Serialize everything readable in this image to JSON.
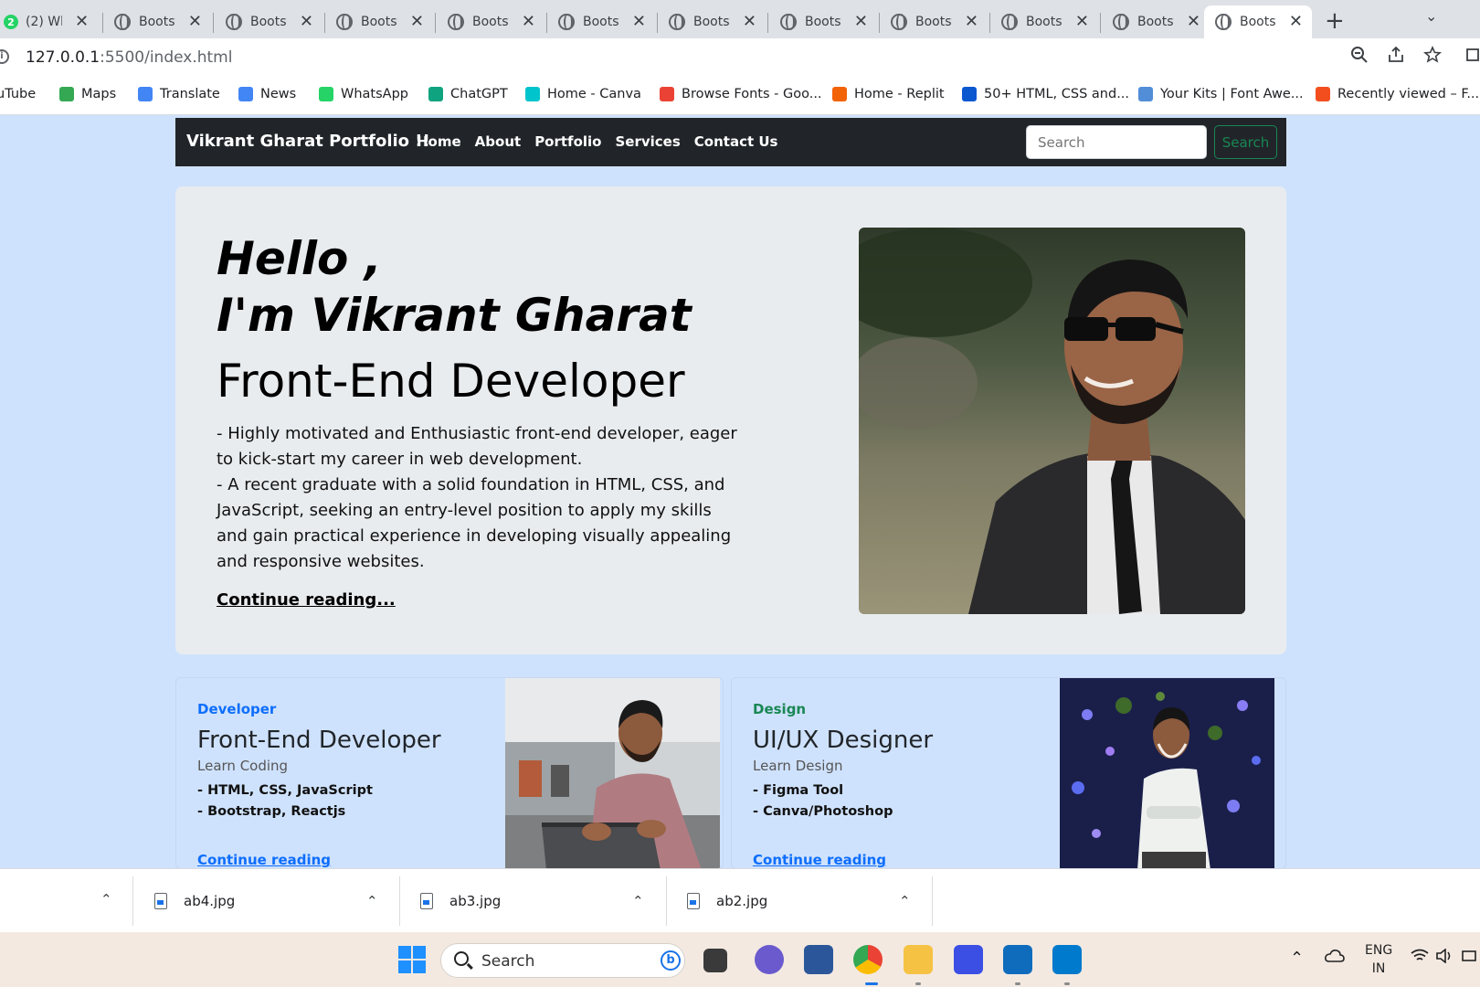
{
  "browser": {
    "tabs": [
      {
        "label": "(2) Wh",
        "kind": "whatsapp",
        "badge": "2"
      },
      {
        "label": "Bootst",
        "kind": "globe"
      },
      {
        "label": "Bootst",
        "kind": "globe"
      },
      {
        "label": "Bootst",
        "kind": "globe"
      },
      {
        "label": "Bootst",
        "kind": "globe"
      },
      {
        "label": "Bootst",
        "kind": "globe"
      },
      {
        "label": "Bootst",
        "kind": "globe"
      },
      {
        "label": "Bootst",
        "kind": "globe"
      },
      {
        "label": "Bootst",
        "kind": "globe"
      },
      {
        "label": "Bootst",
        "kind": "globe"
      },
      {
        "label": "Bootst",
        "kind": "globe"
      },
      {
        "label": "Bootst",
        "kind": "globe",
        "active": true
      }
    ],
    "address": {
      "host": "127.0.0.1",
      "path": ":5500/index.html"
    },
    "bookmarks": [
      {
        "label": "uTube",
        "color": "#ff0000"
      },
      {
        "label": "Maps",
        "color": "#34a853"
      },
      {
        "label": "Translate",
        "color": "#4285f4"
      },
      {
        "label": "News",
        "color": "#4285f4"
      },
      {
        "label": "WhatsApp",
        "color": "#25d366"
      },
      {
        "label": "ChatGPT",
        "color": "#10a37f"
      },
      {
        "label": "Home - Canva",
        "color": "#00c4cc"
      },
      {
        "label": "Browse Fonts - Goo...",
        "color": "#ea4335"
      },
      {
        "label": "Home - Replit",
        "color": "#f26207"
      },
      {
        "label": "50+ HTML, CSS and...",
        "color": "#0b57d0"
      },
      {
        "label": "Your Kits | Font Awe...",
        "color": "#528dd7"
      },
      {
        "label": "Recently viewed – F...",
        "color": "#f24e1e"
      }
    ]
  },
  "navbar": {
    "brand": "Vikrant Gharat Portfolio !!",
    "links": [
      "Home",
      "About",
      "Portfolio",
      "Services",
      "Contact Us"
    ],
    "search_placeholder": "Search",
    "search_button": "Search"
  },
  "hero": {
    "greeting": "Hello ,",
    "name_line": "I'm Vikrant Gharat",
    "role": "Front-End Developer",
    "description_lines": [
      "- Highly motivated and Enthusiastic front-end developer, eager to kick-start my career in web development.",
      "- A recent graduate with a solid foundation in HTML, CSS, and JavaScript, seeking an entry-level position to apply my skills and gain practical experience in developing visually appealing and responsive websites."
    ],
    "link": "Continue reading..."
  },
  "cards": [
    {
      "category": "Developer",
      "category_color": "#0d6efd",
      "title": "Front-End Developer",
      "subtitle": "Learn Coding",
      "items": [
        "- HTML, CSS, JavaScript",
        "- Bootstrap, Reactjs"
      ],
      "link": "Continue reading"
    },
    {
      "category": "Design",
      "category_color": "#198754",
      "title": "UI/UX Designer",
      "subtitle": "Learn Design",
      "items": [
        "- Figma Tool",
        "- Canva/Photoshop"
      ],
      "link": "Continue reading"
    }
  ],
  "downloads": [
    "ab4.jpg",
    "ab3.jpg",
    "ab2.jpg"
  ],
  "taskbar": {
    "search_label": "Search",
    "language": "ENG",
    "region": "IN"
  }
}
